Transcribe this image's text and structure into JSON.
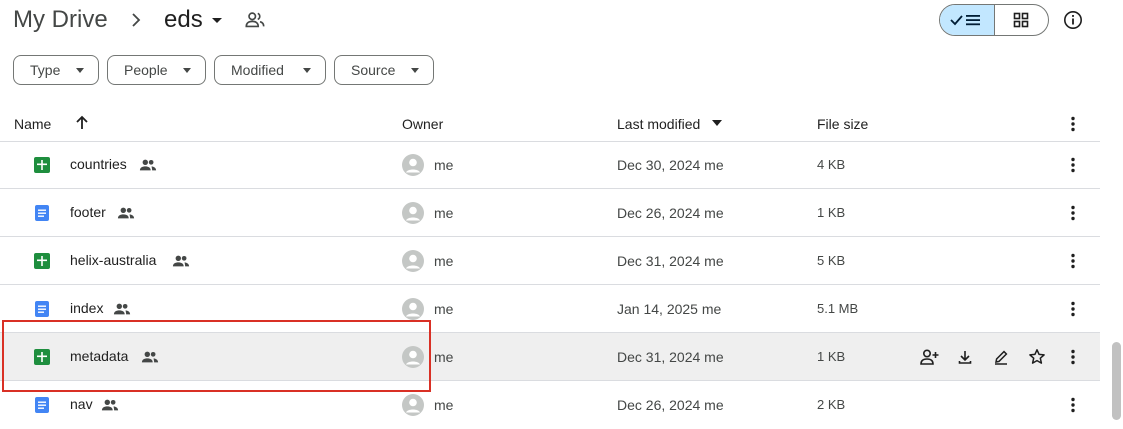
{
  "breadcrumb": {
    "root": "My Drive",
    "folder": "eds"
  },
  "filters": [
    "Type",
    "People",
    "Modified",
    "Source"
  ],
  "columns": {
    "name": "Name",
    "owner": "Owner",
    "modified": "Last modified",
    "size": "File size"
  },
  "colors": {
    "sheets": "#1e8e3e",
    "docs": "#4285f4",
    "highlight": "#d93025",
    "active_toggle": "#c2e7ff",
    "hover_row": "#efefef"
  },
  "rows": [
    {
      "name": "countries",
      "type": "sheets-icon",
      "owner": "me",
      "modified": "Dec 30, 2024 me",
      "size": "4 KB"
    },
    {
      "name": "footer",
      "type": "docs-icon",
      "owner": "me",
      "modified": "Dec 26, 2024 me",
      "size": "1 KB"
    },
    {
      "name": "helix-australia",
      "type": "sheets-icon",
      "owner": "me",
      "modified": "Dec 31, 2024 me",
      "size": "5 KB"
    },
    {
      "name": "index",
      "type": "docs-icon",
      "owner": "me",
      "modified": "Jan 14, 2025 me",
      "size": "5.1 MB"
    },
    {
      "name": "metadata",
      "type": "sheets-icon",
      "owner": "me",
      "modified": "Dec 31, 2024 me",
      "size": "1 KB"
    },
    {
      "name": "nav",
      "type": "docs-icon",
      "owner": "me",
      "modified": "Dec 26, 2024 me",
      "size": "2 KB"
    }
  ]
}
